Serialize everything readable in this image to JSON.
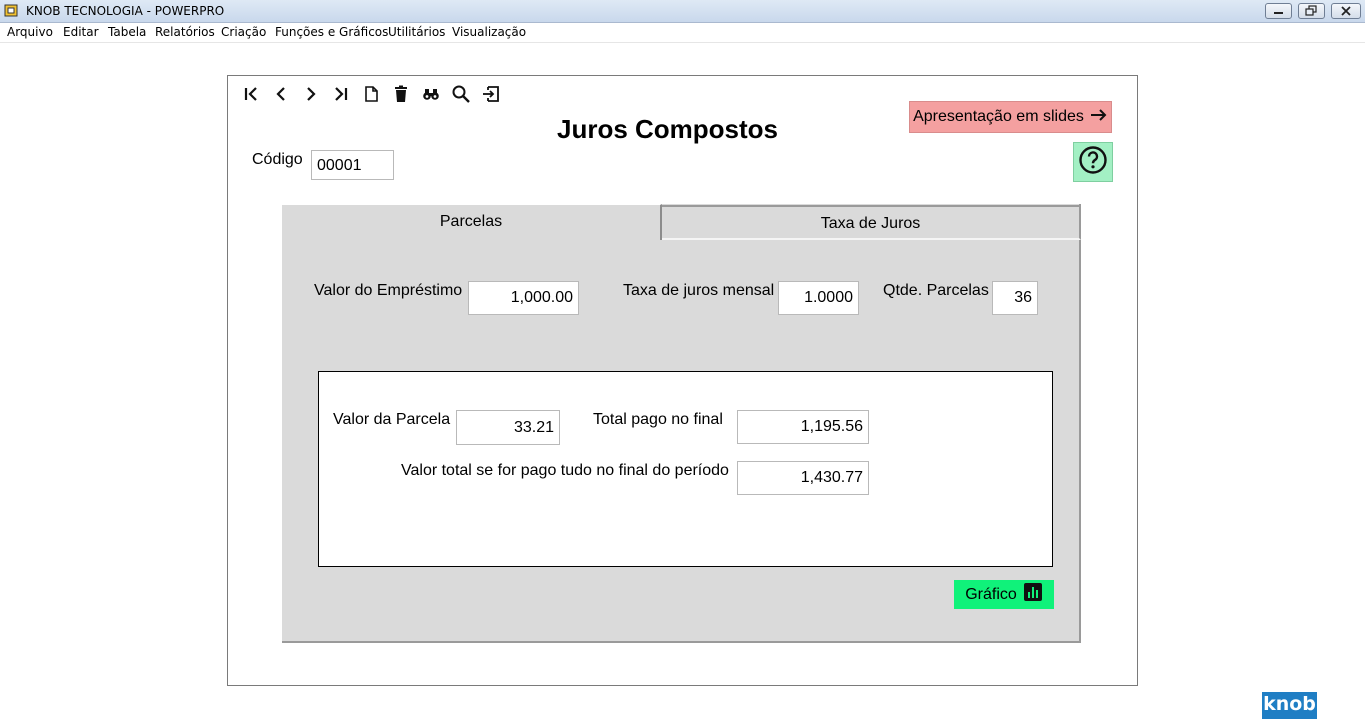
{
  "window": {
    "title": "KNOB TECNOLOGIA - POWERPRO"
  },
  "menu": {
    "items": [
      "Arquivo",
      "Editar",
      "Tabela",
      "Relatórios",
      "Criação",
      "Funções e Gráficos",
      "Utilitários",
      "Visualização"
    ]
  },
  "toolbar": {
    "icons": [
      "first-record-icon",
      "previous-record-icon",
      "next-record-icon",
      "last-record-icon",
      "new-record-icon",
      "delete-icon",
      "find-icon",
      "search-icon",
      "exit-icon"
    ]
  },
  "form": {
    "title": "Juros Compostos",
    "slides_button": "Apresentação em slides",
    "codigo_label": "Código",
    "codigo_value": "00001"
  },
  "tabs": {
    "parcelas": "Parcelas",
    "taxa": "Taxa de Juros"
  },
  "inputs": {
    "valor_emprestimo_label": "Valor do Empréstimo",
    "valor_emprestimo_value": "1,000.00",
    "taxa_label": "Taxa de juros mensal",
    "taxa_value": "1.0000",
    "qtde_label": "Qtde. Parcelas",
    "qtde_value": "36"
  },
  "results": {
    "valor_parcela_label": "Valor da Parcela",
    "valor_parcela_value": "33.21",
    "total_pago_label": "Total pago no final",
    "total_pago_value": "1,195.56",
    "valor_total_label": "Valor total se for pago tudo no final do período",
    "valor_total_value": "1,430.77"
  },
  "grafico_button": "Gráfico",
  "logo": "knob",
  "colors": {
    "slides_button": "#f4a0a0",
    "help_button": "#a3f0c4",
    "grafico_button": "#10f27a",
    "panel": "#dadada",
    "logo": "#1f7ec4"
  }
}
